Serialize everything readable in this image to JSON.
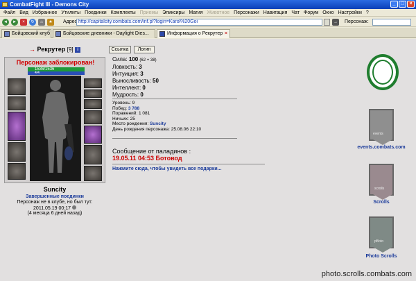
{
  "window": {
    "title": "CombatFight III - Demons City",
    "controls": [
      "_",
      "□",
      "×"
    ]
  },
  "menu": [
    "Файл",
    "Вид",
    "Избранное",
    "Утилиты",
    "Поединки",
    "Комплекты",
    "Приемы",
    "Эликсиры",
    "Магия",
    "Животное",
    "Персонажи",
    "Навигация",
    "Чат",
    "Форум",
    "Окно",
    "Настройки",
    "?"
  ],
  "menu_disabled": [
    "Приемы",
    "Животное"
  ],
  "toolbar": {
    "address_label": "Адрес:",
    "address_value": "http://capitalcity.combats.com/inf.pl?login=Karol%20Goi",
    "person_label": "Персонаж:",
    "person_value": ""
  },
  "tabs": [
    {
      "label": "Бойцовский клуб",
      "active": false
    },
    {
      "label": "Бойцовские дневники - Daylight Dies...",
      "active": false
    },
    {
      "label": "Информация о Рекрутер",
      "active": true
    }
  ],
  "profile": {
    "title_arrow": "→",
    "name": "Рекрутер",
    "level": "[9]",
    "info_icon": "i",
    "buttons": {
      "ssylka": "Ссылка",
      "login": "Логин"
    },
    "blocked_notice": "Персонаж заблокирован!",
    "hp": "1536/1536",
    "mana": "4/4",
    "stats": [
      {
        "label": "Сила:",
        "value": "100",
        "extra": "(62 + 38)"
      },
      {
        "label": "Ловкость:",
        "value": "3",
        "extra": ""
      },
      {
        "label": "Интуиция:",
        "value": "3",
        "extra": ""
      },
      {
        "label": "Выносливость:",
        "value": "50",
        "extra": ""
      },
      {
        "label": "Интеллект:",
        "value": "0",
        "extra": ""
      },
      {
        "label": "Мудрость:",
        "value": "0",
        "extra": ""
      }
    ],
    "details": [
      {
        "label": "Уровень:",
        "value": "9"
      },
      {
        "label": "Побед:",
        "value": "3 788"
      },
      {
        "label": "Поражений:",
        "value": "1 081"
      },
      {
        "label": "Ничьих:",
        "value": "25"
      },
      {
        "label": "Место рождения:",
        "value": "Suncity"
      },
      {
        "label": "День рождения персонажа:",
        "value": "25.08.06 22:10"
      }
    ],
    "city": "Suncity",
    "finished_battles": "Завершенные поединки",
    "not_in_club": "Персонаж не в клубе, но был тут:",
    "last_seen": "2011.05.19 00:17",
    "ago": "(4 месяца 6 дней назад)",
    "paladin_title": "Сообщение от паладинов :",
    "paladin_msg": "19.05.11 04:53 Ботовод",
    "gifts_link": "Нажмите сюда, чтобы увидеть все подарки..."
  },
  "right_column": {
    "events_label": "events.combats.com",
    "events_banner_text": "events",
    "scrolls_label": "Scrolls",
    "scrolls_banner_text": "scrolls",
    "photo_label": "Photo Scrolls",
    "photo_banner_text": "pBoto"
  },
  "watermark": "photo.scrolls.combats.com",
  "colors": {
    "blocked": "#d00000",
    "link": "#1a3a9a",
    "hp": "#1e9a3a",
    "mana": "#2b4fb8",
    "seal": "#1f7d2e"
  }
}
